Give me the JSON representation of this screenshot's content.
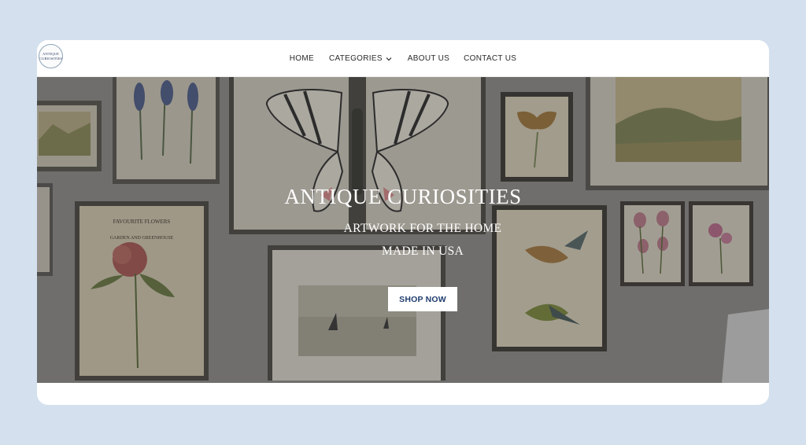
{
  "logo": {
    "line1": "ANTIQUE",
    "line2": "CURIOSITIES"
  },
  "nav": {
    "items": [
      {
        "label": "HOME"
      },
      {
        "label": "CATEGORIES",
        "icon": "chevron-down-icon"
      },
      {
        "label": "ABOUT US"
      },
      {
        "label": "CONTACT US"
      }
    ]
  },
  "hero": {
    "title": "ANTIQUE CURIOSITIES",
    "subtitle_line1": "ARTWORK FOR THE HOME",
    "subtitle_line2": "MADE IN USA",
    "cta_label": "SHOP NOW",
    "print_texts": {
      "flowers_line1": "FAVOURITE FLOWERS",
      "flowers_line2": "GARDEN AND GREENHOUSE"
    }
  },
  "colors": {
    "page_bg": "#d4e0ee",
    "nav_text": "#2a2a2a",
    "cta_text": "#1f3d6e",
    "hero_text": "#ffffff"
  }
}
